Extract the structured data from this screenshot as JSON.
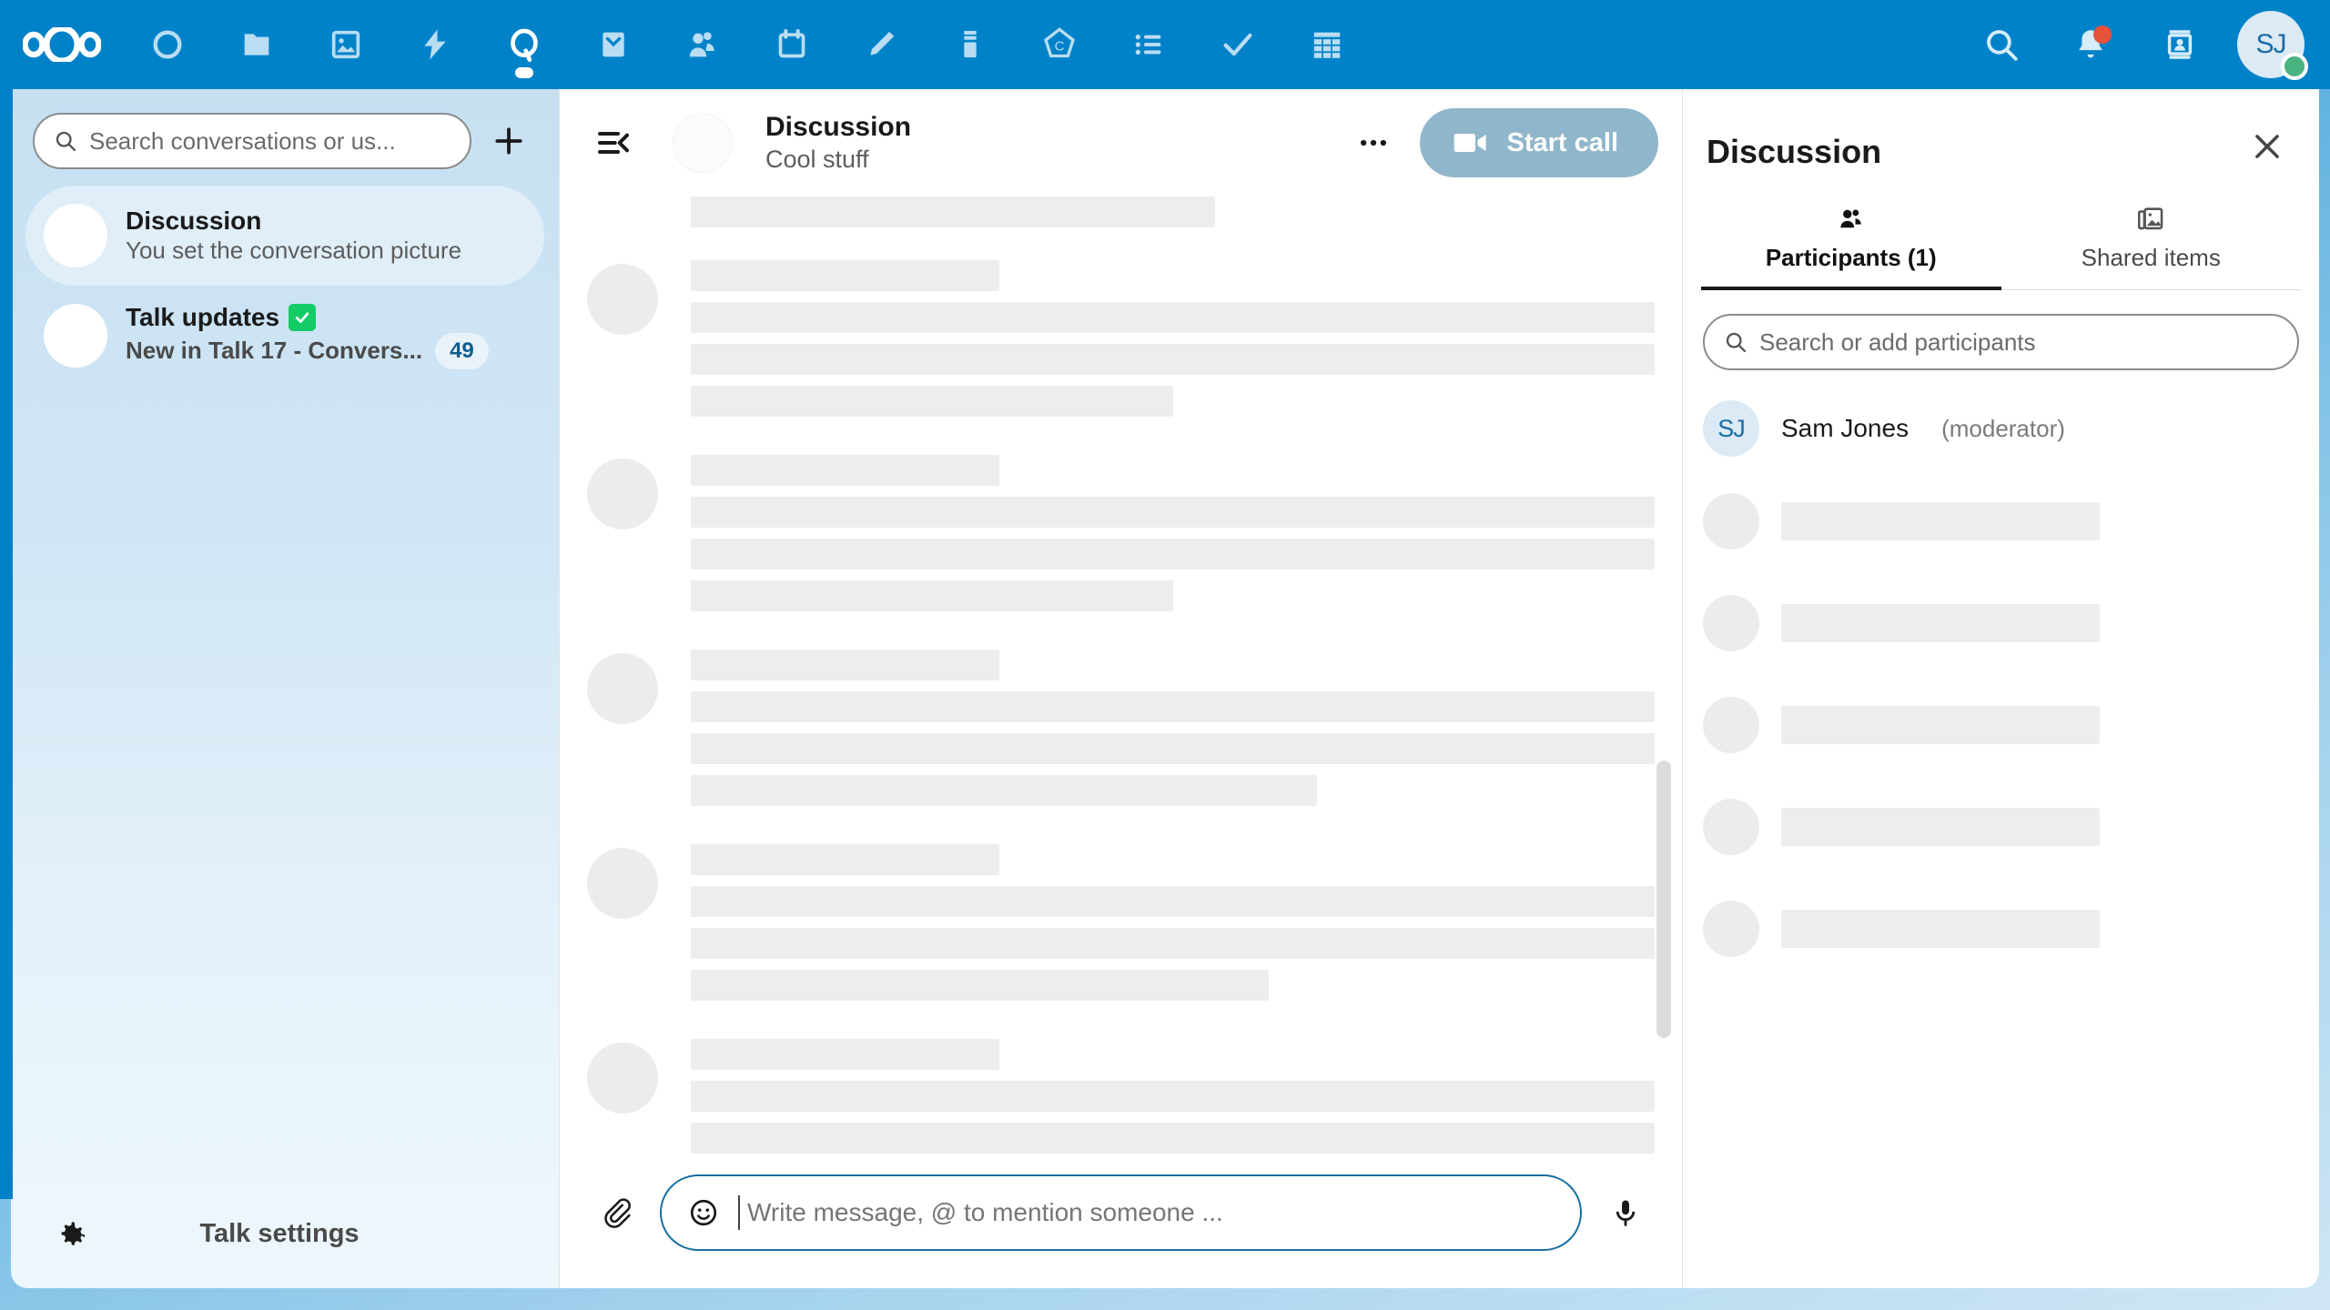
{
  "topbar": {
    "logo_name": "nextcloud-logo",
    "accent_color": "#0082c9",
    "apps": [
      {
        "name": "dashboard",
        "icon": "circle-icon",
        "active": false
      },
      {
        "name": "files",
        "icon": "folder-icon",
        "active": false
      },
      {
        "name": "photos",
        "icon": "photos-icon",
        "active": false
      },
      {
        "name": "activity",
        "icon": "lightning-icon",
        "active": false
      },
      {
        "name": "talk",
        "icon": "talk-icon",
        "active": true
      },
      {
        "name": "mail",
        "icon": "mail-icon",
        "active": false
      },
      {
        "name": "contacts",
        "icon": "contacts-people-icon",
        "active": false
      },
      {
        "name": "calendar",
        "icon": "calendar-icon",
        "active": false
      },
      {
        "name": "notes",
        "icon": "pencil-icon",
        "active": false
      },
      {
        "name": "deck",
        "icon": "deck-icon",
        "active": false
      },
      {
        "name": "collectives",
        "icon": "collectives-icon",
        "active": false
      },
      {
        "name": "tasks",
        "icon": "list-icon",
        "active": false
      },
      {
        "name": "checkmark-app",
        "icon": "check-icon",
        "active": false
      },
      {
        "name": "tables",
        "icon": "tables-icon",
        "active": false
      }
    ],
    "right_icons": [
      {
        "name": "search-icon"
      },
      {
        "name": "notifications-bell-icon",
        "has_dot": true,
        "dot_color": "#e8513a"
      },
      {
        "name": "contacts-menu-icon"
      }
    ],
    "avatar": {
      "initials": "SJ",
      "status": "online",
      "status_color": "#49b382"
    }
  },
  "sidebar": {
    "search": {
      "placeholder": "Search conversations or us...",
      "value": "",
      "icon": "search-icon"
    },
    "add_button_label": "+",
    "conversations": [
      {
        "title": "Discussion",
        "last_message": "You set the conversation picture",
        "selected": true,
        "unread": false,
        "unread_count": "",
        "has_check_badge": false
      },
      {
        "title": "Talk updates",
        "last_message": "New in Talk 17 - Convers...",
        "selected": false,
        "unread": true,
        "unread_count": "49",
        "has_check_badge": true
      }
    ],
    "settings_label": "Talk settings",
    "settings_icon": "gear-icon"
  },
  "chat": {
    "collapse_icon": "collapse-sidebar-icon",
    "title": "Discussion",
    "description": "Cool stuff",
    "more_label": "...",
    "start_call_label": "Start call",
    "start_call_icon": "video-camera-icon",
    "start_call_color": "#8fb6cb",
    "loading_skeleton": {
      "top_partial_bar_width": "56%",
      "blocks": [
        {
          "widths": [
            "32%",
            "100%",
            "100%",
            "50%"
          ]
        },
        {
          "widths": [
            "32%",
            "100%",
            "100%",
            "50%"
          ]
        },
        {
          "widths": [
            "32%",
            "100%",
            "100%",
            "65%"
          ]
        },
        {
          "widths": [
            "32%",
            "100%",
            "100%",
            "60%"
          ]
        },
        {
          "widths": [
            "32%",
            "100%",
            "100%",
            "65%"
          ]
        }
      ]
    },
    "composer": {
      "attach_icon": "paperclip-icon",
      "emoji_icon": "emoji-smiley-icon",
      "placeholder": "Write message, @ to mention someone ...",
      "value": "",
      "mic_icon": "microphone-icon"
    }
  },
  "right_panel": {
    "title": "Discussion",
    "close_icon": "close-icon",
    "tabs": [
      {
        "label": "Participants (1)",
        "icon": "people-icon",
        "active": true
      },
      {
        "label": "Shared items",
        "icon": "shared-items-icon",
        "active": false
      }
    ],
    "search": {
      "placeholder": "Search or add participants",
      "value": "",
      "icon": "search-icon"
    },
    "participants": [
      {
        "initials": "SJ",
        "name": "Sam Jones",
        "role": "(moderator)"
      }
    ],
    "skeleton_rows": 5
  }
}
